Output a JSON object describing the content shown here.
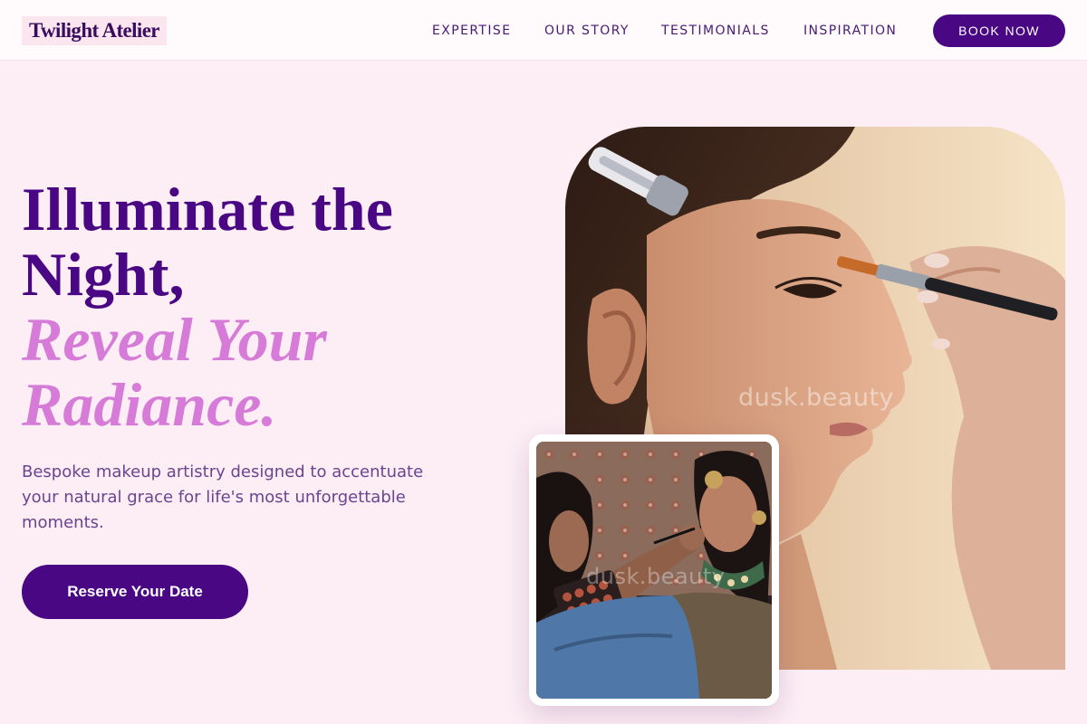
{
  "brand": {
    "name": "Twilight Atelier"
  },
  "nav": {
    "items": [
      "EXPERTISE",
      "OUR STORY",
      "TESTIMONIALS",
      "INSPIRATION"
    ],
    "cta": "BOOK NOW"
  },
  "hero": {
    "headline_lines": [
      "Illuminate the",
      "Night,"
    ],
    "headline_accent_lines": [
      "Reveal Your",
      "Radiance."
    ],
    "subtext": "Bespoke makeup artistry designed to accentuate your natural grace for life's most unforgettable moments.",
    "cta": "Reserve Your Date"
  },
  "images": {
    "main_watermark": "dusk.beauty",
    "inset_watermark": "dusk.beauty"
  },
  "colors": {
    "background": "#fdeef5",
    "primary": "#4a0784",
    "accent": "#d67bd8",
    "body_text": "#6b4391"
  }
}
